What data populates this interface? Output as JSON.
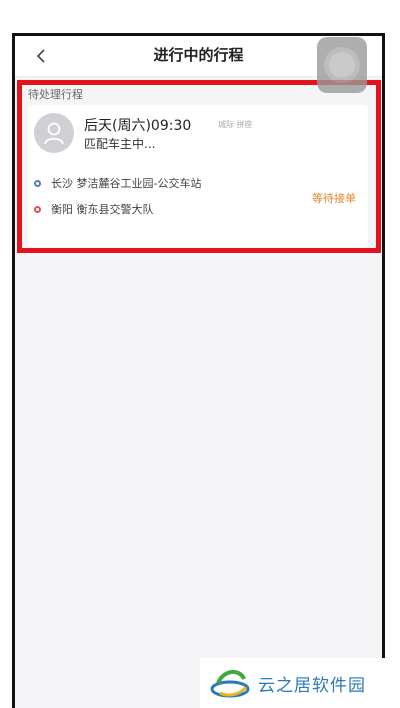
{
  "navbar": {
    "title": "进行中的行程",
    "back_icon": "chevron-left-icon"
  },
  "pending": {
    "section_label": "待处理行程",
    "trip": {
      "time": "后天(周六)09:30",
      "tag": "城际·拼座",
      "status": "匹配车主中...",
      "from": "长沙 梦洁麓谷工业园-公交车站",
      "to": "衡阳 衡东县交警大队",
      "waiting_label": "等待接单",
      "avatar_icon": "user-avatar-icon"
    }
  },
  "floating_button": {
    "icon": "assistive-touch-icon"
  },
  "watermark": {
    "text": "云之居软件园",
    "logo_icon": "yunzhiju-logo-icon"
  },
  "colors": {
    "highlight_border": "#e3121d",
    "waiting": "#e08a2b",
    "start_dot": "#5d7ea3",
    "end_dot": "#d9534f"
  }
}
